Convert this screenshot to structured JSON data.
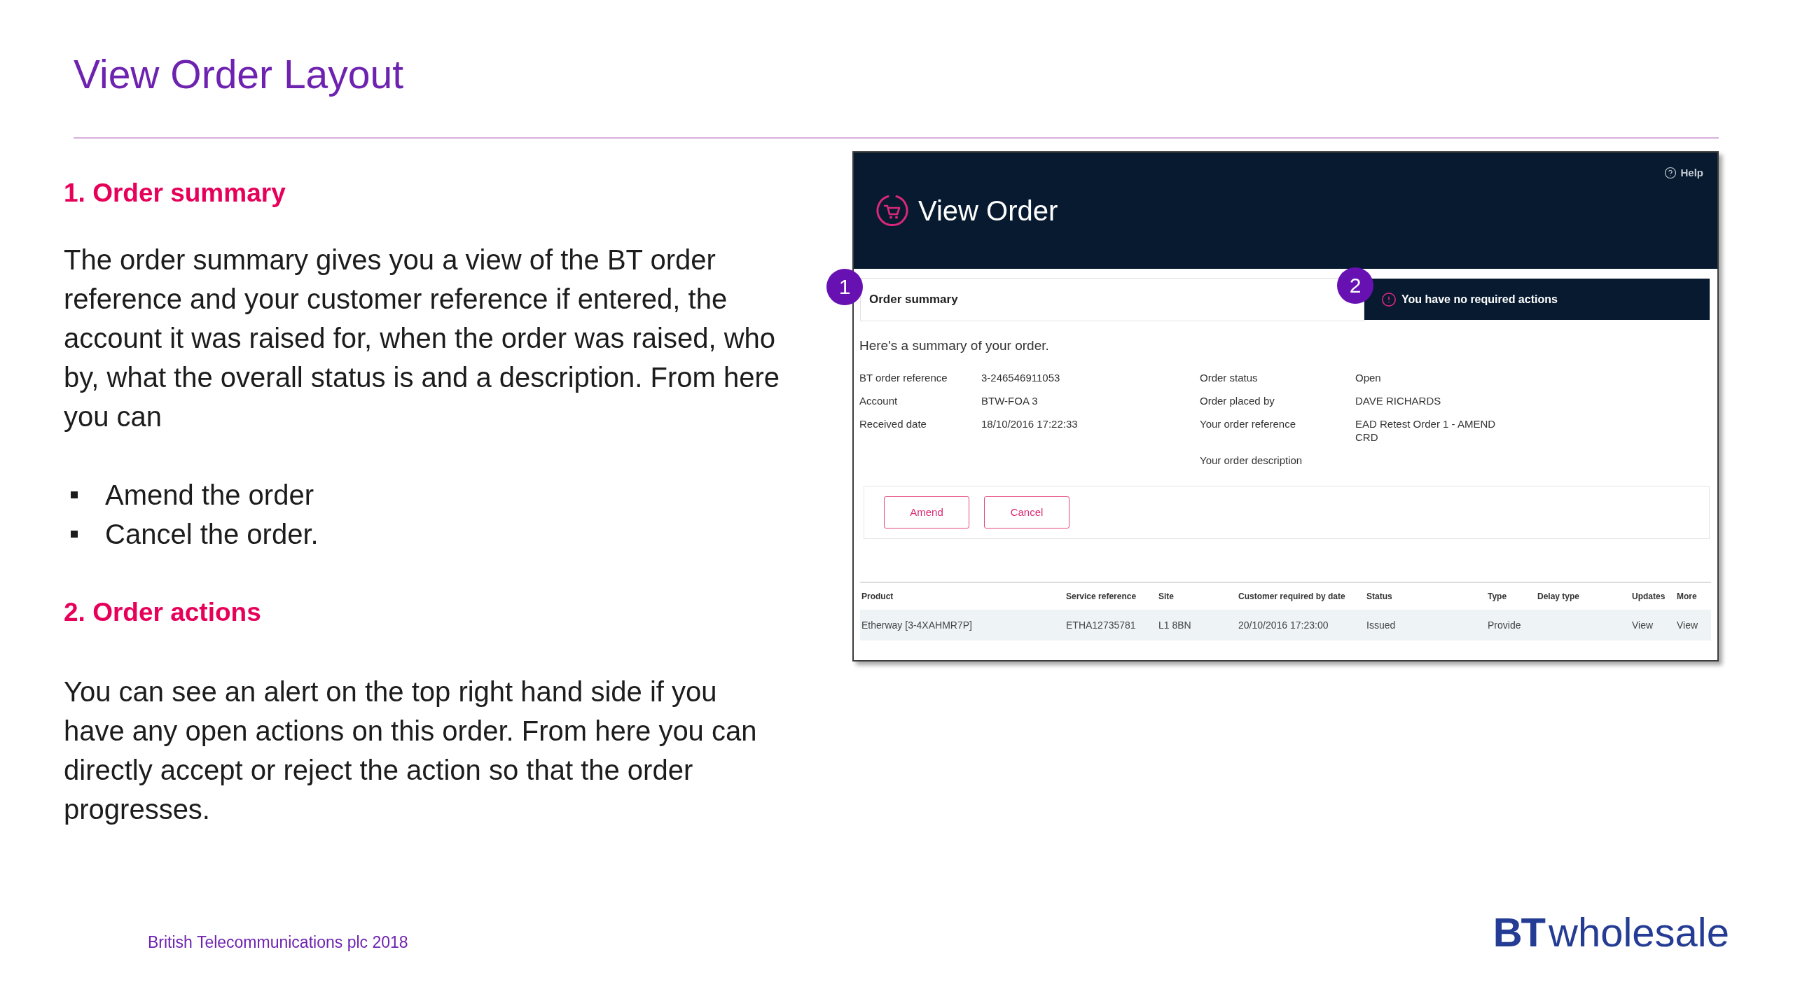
{
  "title": "View Order Layout",
  "sections": [
    {
      "heading": "1. Order summary",
      "body": "The order summary gives you a view of the BT order reference and your customer reference if entered, the account it was raised for, when the order was raised, who by, what the overall status is and a description. From here you can",
      "bullets": [
        "Amend the order",
        "Cancel the order."
      ]
    },
    {
      "heading": "2. Order actions",
      "body": "You can see an alert on the top right hand side if you have any open actions on this order. From here you can directly accept or reject the action so that the order progresses."
    }
  ],
  "screenshot": {
    "help_link": "Help",
    "page_title": "View Order",
    "summary_panel": {
      "callout": "1",
      "title": "Order summary"
    },
    "alert": {
      "callout": "2",
      "text": "You have no required actions"
    },
    "intro": "Here's a summary of your order.",
    "details_left": [
      {
        "label": "BT order reference",
        "value": "3-246546911053"
      },
      {
        "label": "Account",
        "value": "BTW-FOA 3"
      },
      {
        "label": "Received date",
        "value": "18/10/2016 17:22:33"
      }
    ],
    "details_right": [
      {
        "label": "Order status",
        "value": "Open"
      },
      {
        "label": "Order placed by",
        "value": "DAVE RICHARDS"
      },
      {
        "label": "Your order reference",
        "value": "EAD Retest Order 1 - AMEND CRD"
      },
      {
        "label": "Your order description"
      }
    ],
    "buttons": [
      "Amend",
      "Cancel"
    ],
    "table": {
      "columns": [
        "Product",
        "Service reference",
        "Site",
        "Customer required by date",
        "Status",
        "Type",
        "Delay type",
        "Updates",
        "More"
      ],
      "rows": [
        {
          "cells": [
            "Etherway [3-4XAHMR7P]",
            "ETHA12735781",
            "L1 8BN",
            "20/10/2016 17:23:00",
            "Issued",
            "Provide",
            null,
            "View",
            "View"
          ]
        }
      ]
    }
  },
  "footer": {
    "copyright": "British Telecommunications plc 2018",
    "logo": {
      "mark": "BT",
      "wordmark": "wholesale"
    }
  }
}
